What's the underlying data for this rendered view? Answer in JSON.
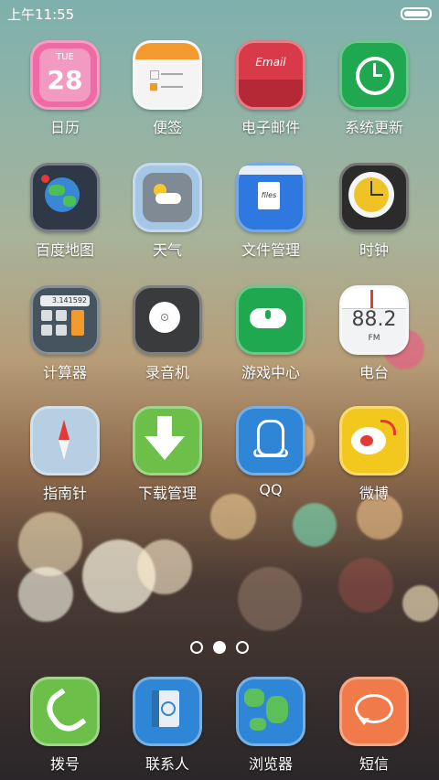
{
  "status_bar": {
    "time": "上午11:55"
  },
  "apps": [
    {
      "label": "日历",
      "icon": "calendar-icon",
      "date_day": "TUE",
      "date_num": "28"
    },
    {
      "label": "便签",
      "icon": "notes-icon"
    },
    {
      "label": "电子邮件",
      "icon": "email-icon",
      "mini_text": "Email"
    },
    {
      "label": "系统更新",
      "icon": "system-update-icon"
    },
    {
      "label": "百度地图",
      "icon": "map-icon"
    },
    {
      "label": "天气",
      "icon": "weather-icon"
    },
    {
      "label": "文件管理",
      "icon": "files-icon",
      "mini_text": "files"
    },
    {
      "label": "时钟",
      "icon": "clock-icon"
    },
    {
      "label": "计算器",
      "icon": "calculator-icon",
      "calc_display": "3.141592"
    },
    {
      "label": "录音机",
      "icon": "recorder-icon"
    },
    {
      "label": "游戏中心",
      "icon": "game-center-icon"
    },
    {
      "label": "电台",
      "icon": "radio-icon",
      "freq": "88.2",
      "fm": "FM"
    },
    {
      "label": "指南针",
      "icon": "compass-icon"
    },
    {
      "label": "下载管理",
      "icon": "download-icon"
    },
    {
      "label": "QQ",
      "icon": "qq-icon"
    },
    {
      "label": "微博",
      "icon": "weibo-icon"
    }
  ],
  "page_dots": {
    "count": 3,
    "active": 1
  },
  "dock": [
    {
      "label": "拨号",
      "icon": "phone-icon"
    },
    {
      "label": "联系人",
      "icon": "contacts-icon"
    },
    {
      "label": "浏览器",
      "icon": "browser-icon"
    },
    {
      "label": "短信",
      "icon": "messages-icon"
    }
  ]
}
